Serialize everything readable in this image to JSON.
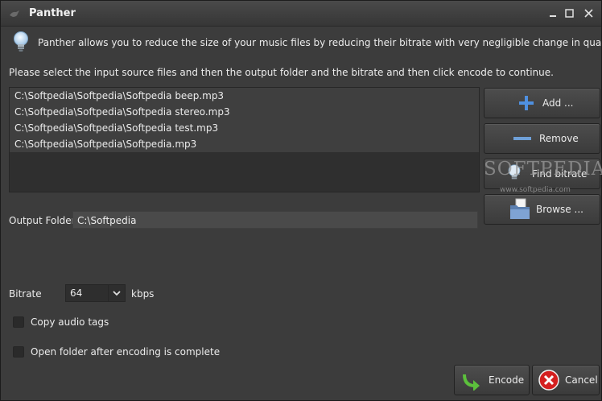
{
  "window": {
    "title": "Panther"
  },
  "info": {
    "text": "Panther allows you to reduce the size of your music files by reducing their bitrate with very negligible change in quality."
  },
  "instructions": "Please select the input source files and then the output folder and the bitrate and then click encode to continue.",
  "files": [
    "C:\\Softpedia\\Softpedia\\Softpedia beep.mp3",
    "C:\\Softpedia\\Softpedia\\Softpedia stereo.mp3",
    "C:\\Softpedia\\Softpedia\\Softpedia test.mp3",
    "C:\\Softpedia\\Softpedia\\Softpedia.mp3"
  ],
  "buttons": {
    "add": "Add ...",
    "remove": "Remove",
    "find_bitrate": "Find bitrate",
    "browse": "Browse ...",
    "encode": "Encode",
    "cancel": "Cancel"
  },
  "output": {
    "label": "Output Folder",
    "value": "C:\\Softpedia"
  },
  "bitrate": {
    "label": "Bitrate",
    "value": "64",
    "unit": "kbps"
  },
  "options": {
    "copy_tags": {
      "label": "Copy audio tags",
      "checked": false
    },
    "open_folder": {
      "label": "Open folder after encoding is complete",
      "checked": false
    }
  },
  "watermark": {
    "text": "SOFTPEDIA",
    "url": "www.softpedia.com"
  },
  "colors": {
    "background": "#3c3c3c",
    "add_icon": "#4f90e0",
    "encode_icon": "#5cc03c",
    "cancel_icon": "#d42020"
  }
}
